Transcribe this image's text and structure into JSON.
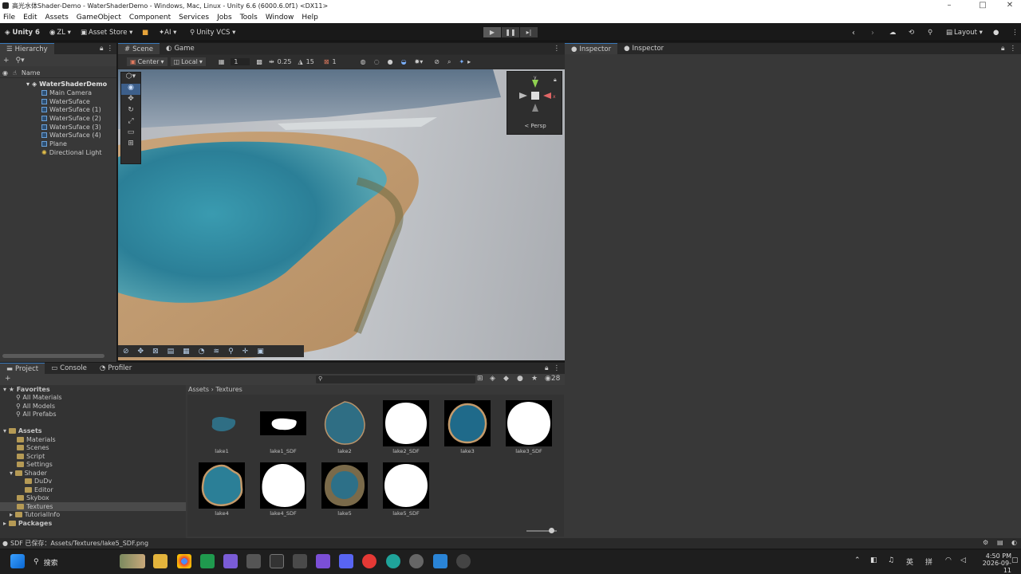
{
  "window": {
    "title": "高光水体Shader-Demo - WaterShaderDemo - Windows, Mac, Linux - Unity 6.6 (6000.6.0f1) <DX11>"
  },
  "menu": [
    "File",
    "Edit",
    "Assets",
    "GameObject",
    "Component",
    "Services",
    "Jobs",
    "Tools",
    "Window",
    "Help"
  ],
  "toolbar": {
    "unity": "Unity 6",
    "account": "ZL",
    "asset_store": "Asset Store",
    "ai": "AI",
    "vcs": "Unity VCS",
    "layout": "Layout"
  },
  "hierarchy": {
    "tab": "Hierarchy",
    "column": "Name",
    "root": "WaterShaderDemo",
    "items": [
      "Main Camera",
      "WaterSuface",
      "WaterSuface (1)",
      "WaterSuface (2)",
      "WaterSuface (3)",
      "WaterSuface (4)",
      "Plane",
      "Directional Light"
    ]
  },
  "scene": {
    "tabs": [
      "Scene",
      "Game"
    ],
    "pivot": "Center",
    "space": "Local",
    "layer_count": "1",
    "snap_value": "0.25",
    "angle": "15",
    "scale_snap": "1",
    "gizmo_label": "< Persp",
    "axis_y": "y",
    "axis_x": "x"
  },
  "bottom_tabs": [
    "Project",
    "Console",
    "Profiler"
  ],
  "project": {
    "favorites_label": "Favorites",
    "favorites": [
      "All Materials",
      "All Models",
      "All Prefabs"
    ],
    "assets_label": "Assets",
    "folders": [
      "Materials",
      "Scenes",
      "Script",
      "Settings",
      "Shader",
      "Skybox",
      "Textures",
      "TutorialInfo"
    ],
    "shader_sub": [
      "DuDv",
      "Editor"
    ],
    "packages": "Packages",
    "breadcrumb": [
      "Assets",
      "Textures"
    ],
    "count": "28",
    "assets": [
      "lake1",
      "lake1_SDF",
      "lake2",
      "lake2_SDF",
      "lake3",
      "lake3_SDF",
      "lake4",
      "lake4_SDF",
      "lake5",
      "lake5_SDF"
    ]
  },
  "inspector": {
    "tabs": [
      "Inspector",
      "Inspector"
    ]
  },
  "status": {
    "text": "SDF 已保存：Assets/Textures/lake5_SDF.png"
  },
  "taskbar": {
    "search": "搜索",
    "time": "4:50 PM",
    "date": "2026-09-11",
    "ime1": "英",
    "ime2": "拼"
  }
}
